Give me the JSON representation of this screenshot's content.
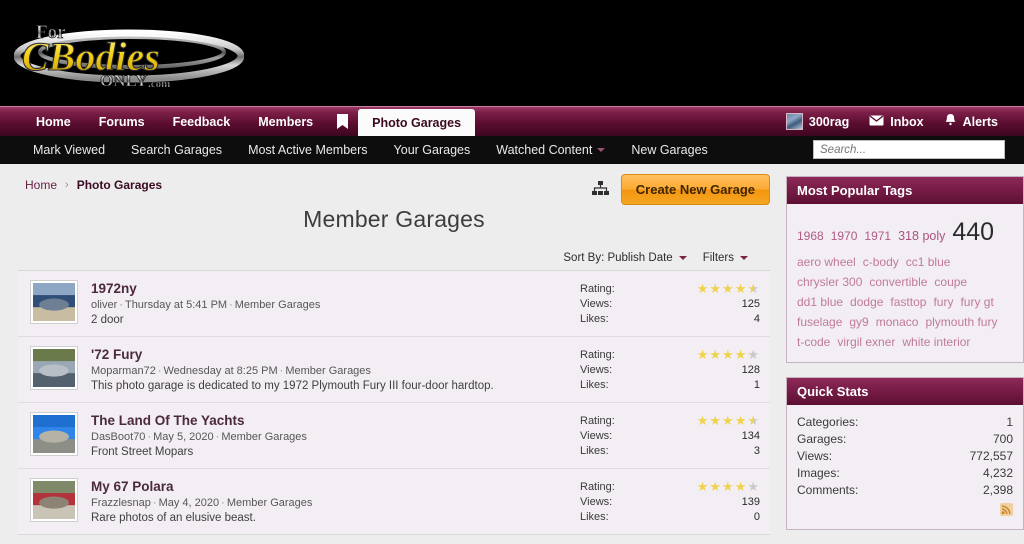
{
  "site": {
    "logo_top": "For",
    "logo_main": "CBodies",
    "logo_bottom": "ONLY",
    "logo_suffix": ".com"
  },
  "nav": {
    "items": [
      {
        "label": "Home",
        "active": false
      },
      {
        "label": "Forums",
        "active": false
      },
      {
        "label": "Feedback",
        "active": false
      },
      {
        "label": "Members",
        "active": false
      }
    ],
    "bookmark_icon": "bookmark-icon",
    "active_tab": "Photo Garages",
    "user": {
      "name": "300rag",
      "inbox_label": "Inbox",
      "alerts_label": "Alerts"
    }
  },
  "subnav": {
    "items": [
      {
        "label": "Mark Viewed",
        "caret": false
      },
      {
        "label": "Search Garages",
        "caret": false
      },
      {
        "label": "Most Active Members",
        "caret": false
      },
      {
        "label": "Your Garages",
        "caret": false
      },
      {
        "label": "Watched Content",
        "caret": true
      },
      {
        "label": "New Garages",
        "caret": false
      }
    ],
    "search_placeholder": "Search...",
    "search_value": ""
  },
  "breadcrumb": {
    "home": "Home",
    "separator": "›",
    "current": "Photo Garages"
  },
  "header": {
    "title": "Member Garages",
    "create_button": "Create New Garage",
    "tree_icon": "sitemap-icon"
  },
  "sort_bar": {
    "sort_label": "Sort By: Publish Date",
    "filters_label": "Filters"
  },
  "garages": [
    {
      "title": "1972ny",
      "author": "oliver",
      "date": "Thursday at 5:41 PM",
      "category": "Member Garages",
      "description": "2 door",
      "rating": 4.5,
      "rating_label": "Rating:",
      "views_label": "Views:",
      "likes_label": "Likes:",
      "views": "125",
      "likes": "4",
      "thumb_colors": [
        "#8ea7c4",
        "#2f4f78",
        "#c8bda2",
        "#6e7f94"
      ]
    },
    {
      "title": "'72 Fury",
      "author": "Moparman72",
      "date": "Wednesday at 8:25 PM",
      "category": "Member Garages",
      "description": "This photo garage is dedicated to my 1972 Plymouth Fury III four-door hardtop.",
      "rating": 4,
      "rating_label": "Rating:",
      "views_label": "Views:",
      "likes_label": "Likes:",
      "views": "128",
      "likes": "1",
      "thumb_colors": [
        "#6b7a4a",
        "#9aa7b4",
        "#53606e",
        "#b9bfc6"
      ]
    },
    {
      "title": "The Land Of The Yachts",
      "author": "DasBoot70",
      "date": "May 5, 2020",
      "category": "Member Garages",
      "description": "Front Street Mopars",
      "rating": 4.5,
      "rating_label": "Rating:",
      "views_label": "Views:",
      "likes_label": "Likes:",
      "views": "134",
      "likes": "3",
      "thumb_colors": [
        "#1f6fd0",
        "#2f86e8",
        "#8d8f86",
        "#b5b3a6"
      ]
    },
    {
      "title": "My 67 Polara",
      "author": "Frazzlesnap",
      "date": "May 4, 2020",
      "category": "Member Garages",
      "description": "Rare photos of an elusive beast.",
      "rating": 4,
      "rating_label": "Rating:",
      "views_label": "Views:",
      "likes_label": "Likes:",
      "views": "139",
      "likes": "0",
      "thumb_colors": [
        "#7e8a6a",
        "#b4333a",
        "#c9c4b6",
        "#8d8374"
      ]
    }
  ],
  "sidebar": {
    "tags_title": "Most Popular Tags",
    "tags": [
      {
        "label": "1968",
        "size": 12,
        "color": "#b05c86"
      },
      {
        "label": "1970",
        "size": 12,
        "color": "#b05c86"
      },
      {
        "label": "1971",
        "size": 12,
        "color": "#b05c86"
      },
      {
        "label": "318 poly",
        "size": 12.5,
        "color": "#a9537f"
      },
      {
        "label": "440",
        "size": 25,
        "color": "#2b2b2b"
      },
      {
        "label": "aero wheel",
        "size": 12,
        "color": "#c07a9c"
      },
      {
        "label": "c-body",
        "size": 12,
        "color": "#c07a9c"
      },
      {
        "label": "cc1 blue",
        "size": 12,
        "color": "#c07a9c"
      },
      {
        "label": "chrysler 300",
        "size": 12,
        "color": "#c07a9c"
      },
      {
        "label": "convertible",
        "size": 12,
        "color": "#c07a9c"
      },
      {
        "label": "coupe",
        "size": 12,
        "color": "#c07a9c"
      },
      {
        "label": "dd1 blue",
        "size": 12,
        "color": "#c07a9c"
      },
      {
        "label": "dodge",
        "size": 12,
        "color": "#c07a9c"
      },
      {
        "label": "fasttop",
        "size": 12,
        "color": "#c07a9c"
      },
      {
        "label": "fury",
        "size": 12,
        "color": "#c07a9c"
      },
      {
        "label": "fury gt",
        "size": 12,
        "color": "#c07a9c"
      },
      {
        "label": "fuselage",
        "size": 12,
        "color": "#c07a9c"
      },
      {
        "label": "gy9",
        "size": 12,
        "color": "#c07a9c"
      },
      {
        "label": "monaco",
        "size": 12,
        "color": "#c07a9c"
      },
      {
        "label": "plymouth fury",
        "size": 12,
        "color": "#c07a9c"
      },
      {
        "label": "t-code",
        "size": 12,
        "color": "#c07a9c"
      },
      {
        "label": "virgil exner",
        "size": 12,
        "color": "#c07a9c"
      },
      {
        "label": "white interior",
        "size": 12,
        "color": "#c07a9c"
      }
    ],
    "stats_title": "Quick Stats",
    "stats": [
      {
        "label": "Categories:",
        "value": "1"
      },
      {
        "label": "Garages:",
        "value": "700"
      },
      {
        "label": "Views:",
        "value": "772,557"
      },
      {
        "label": "Images:",
        "value": "4,232"
      },
      {
        "label": "Comments:",
        "value": "2,398"
      }
    ],
    "rss_icon": "rss-icon"
  }
}
